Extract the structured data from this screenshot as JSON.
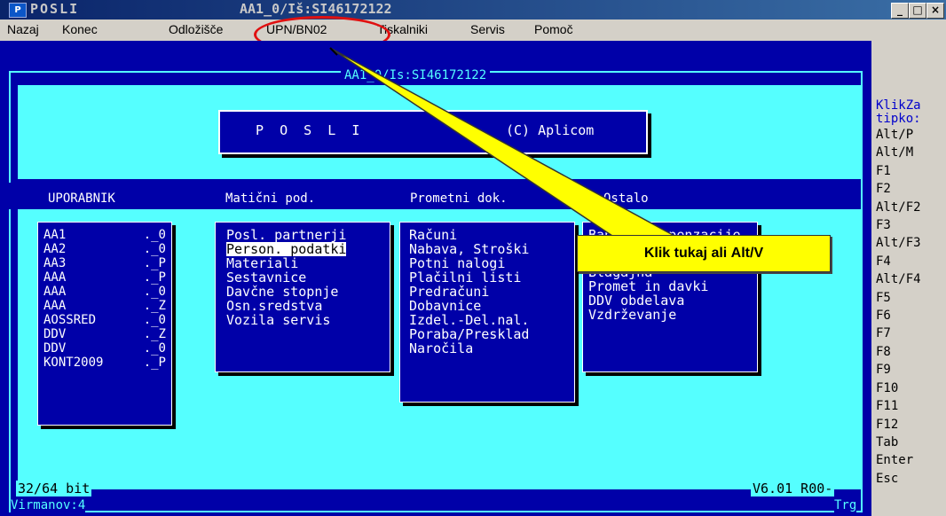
{
  "window": {
    "app_name": "POSLI",
    "doc_title": "AA1_0/Iš:SI46172122",
    "controls": [
      "_",
      "□",
      "×"
    ]
  },
  "menu": [
    "Nazaj",
    "Konec",
    "Odložišče",
    "UPN/BN02",
    "Tiskalniki",
    "Servis",
    "Pomoč"
  ],
  "dos": {
    "frame_title": "AA1_0/Is:SI46172122",
    "banner_left": "P  O  S  L  I",
    "banner_right": "(C) Aplicom",
    "headers": [
      "UPORABNIK",
      "Matični pod.",
      "Prometni dok.",
      "Ostalo"
    ],
    "users": [
      {
        "name": "AA1",
        "code": "._0"
      },
      {
        "name": "AA2",
        "code": "._0"
      },
      {
        "name": "AA3",
        "code": "._P"
      },
      {
        "name": "AAA",
        "code": "._P"
      },
      {
        "name": "AAA",
        "code": "._0"
      },
      {
        "name": "AAA",
        "code": "._Z"
      },
      {
        "name": "AOSSRED",
        "code": "._0"
      },
      {
        "name": "DDV",
        "code": "._Z"
      },
      {
        "name": "DDV",
        "code": "._0"
      },
      {
        "name": "KONT2009",
        "code": "._P"
      }
    ],
    "maticni": [
      "Posl. partnerji",
      "Person. podatki",
      "Materiali",
      "Sestavnice",
      "Davčne stopnje",
      "Osn.sredstva",
      "Vozila servis"
    ],
    "maticni_selected": 1,
    "promet": [
      "Računi",
      "Nabava, Stroški",
      "Potni nalogi",
      "Plačilni listi",
      "Predračuni",
      "Dobavnice",
      "Izdel.-Del.nal.",
      "Poraba/Presklad",
      "Naročila"
    ],
    "ostalo": [
      "Banka, Kompenzacije",
      "Blagajna",
      "Promet in davki",
      "DDV obdelava",
      "Vzdrževanje"
    ],
    "ostalo_visible_first": "Ba",
    "ostalo_partial_first": "lmije",
    "status_left": "32/64 bit",
    "status_right": "V6.01 R00-",
    "footer_left": "Virmanov:4",
    "footer_right": "Trg"
  },
  "right_panel": {
    "title_line1": "KlikZa",
    "title_line2": "tipko:",
    "keys": [
      "Alt/P",
      "Alt/M",
      "F1",
      "F2",
      "Alt/F2",
      "F3",
      "Alt/F3",
      "F4",
      "Alt/F4",
      "F5",
      "F6",
      "F7",
      "F8",
      "F9",
      "F10",
      "F11",
      "F12",
      "Tab",
      "Enter",
      "Esc"
    ]
  },
  "callout": {
    "text": "Klik tukaj ali ",
    "bold": "Alt/V"
  }
}
